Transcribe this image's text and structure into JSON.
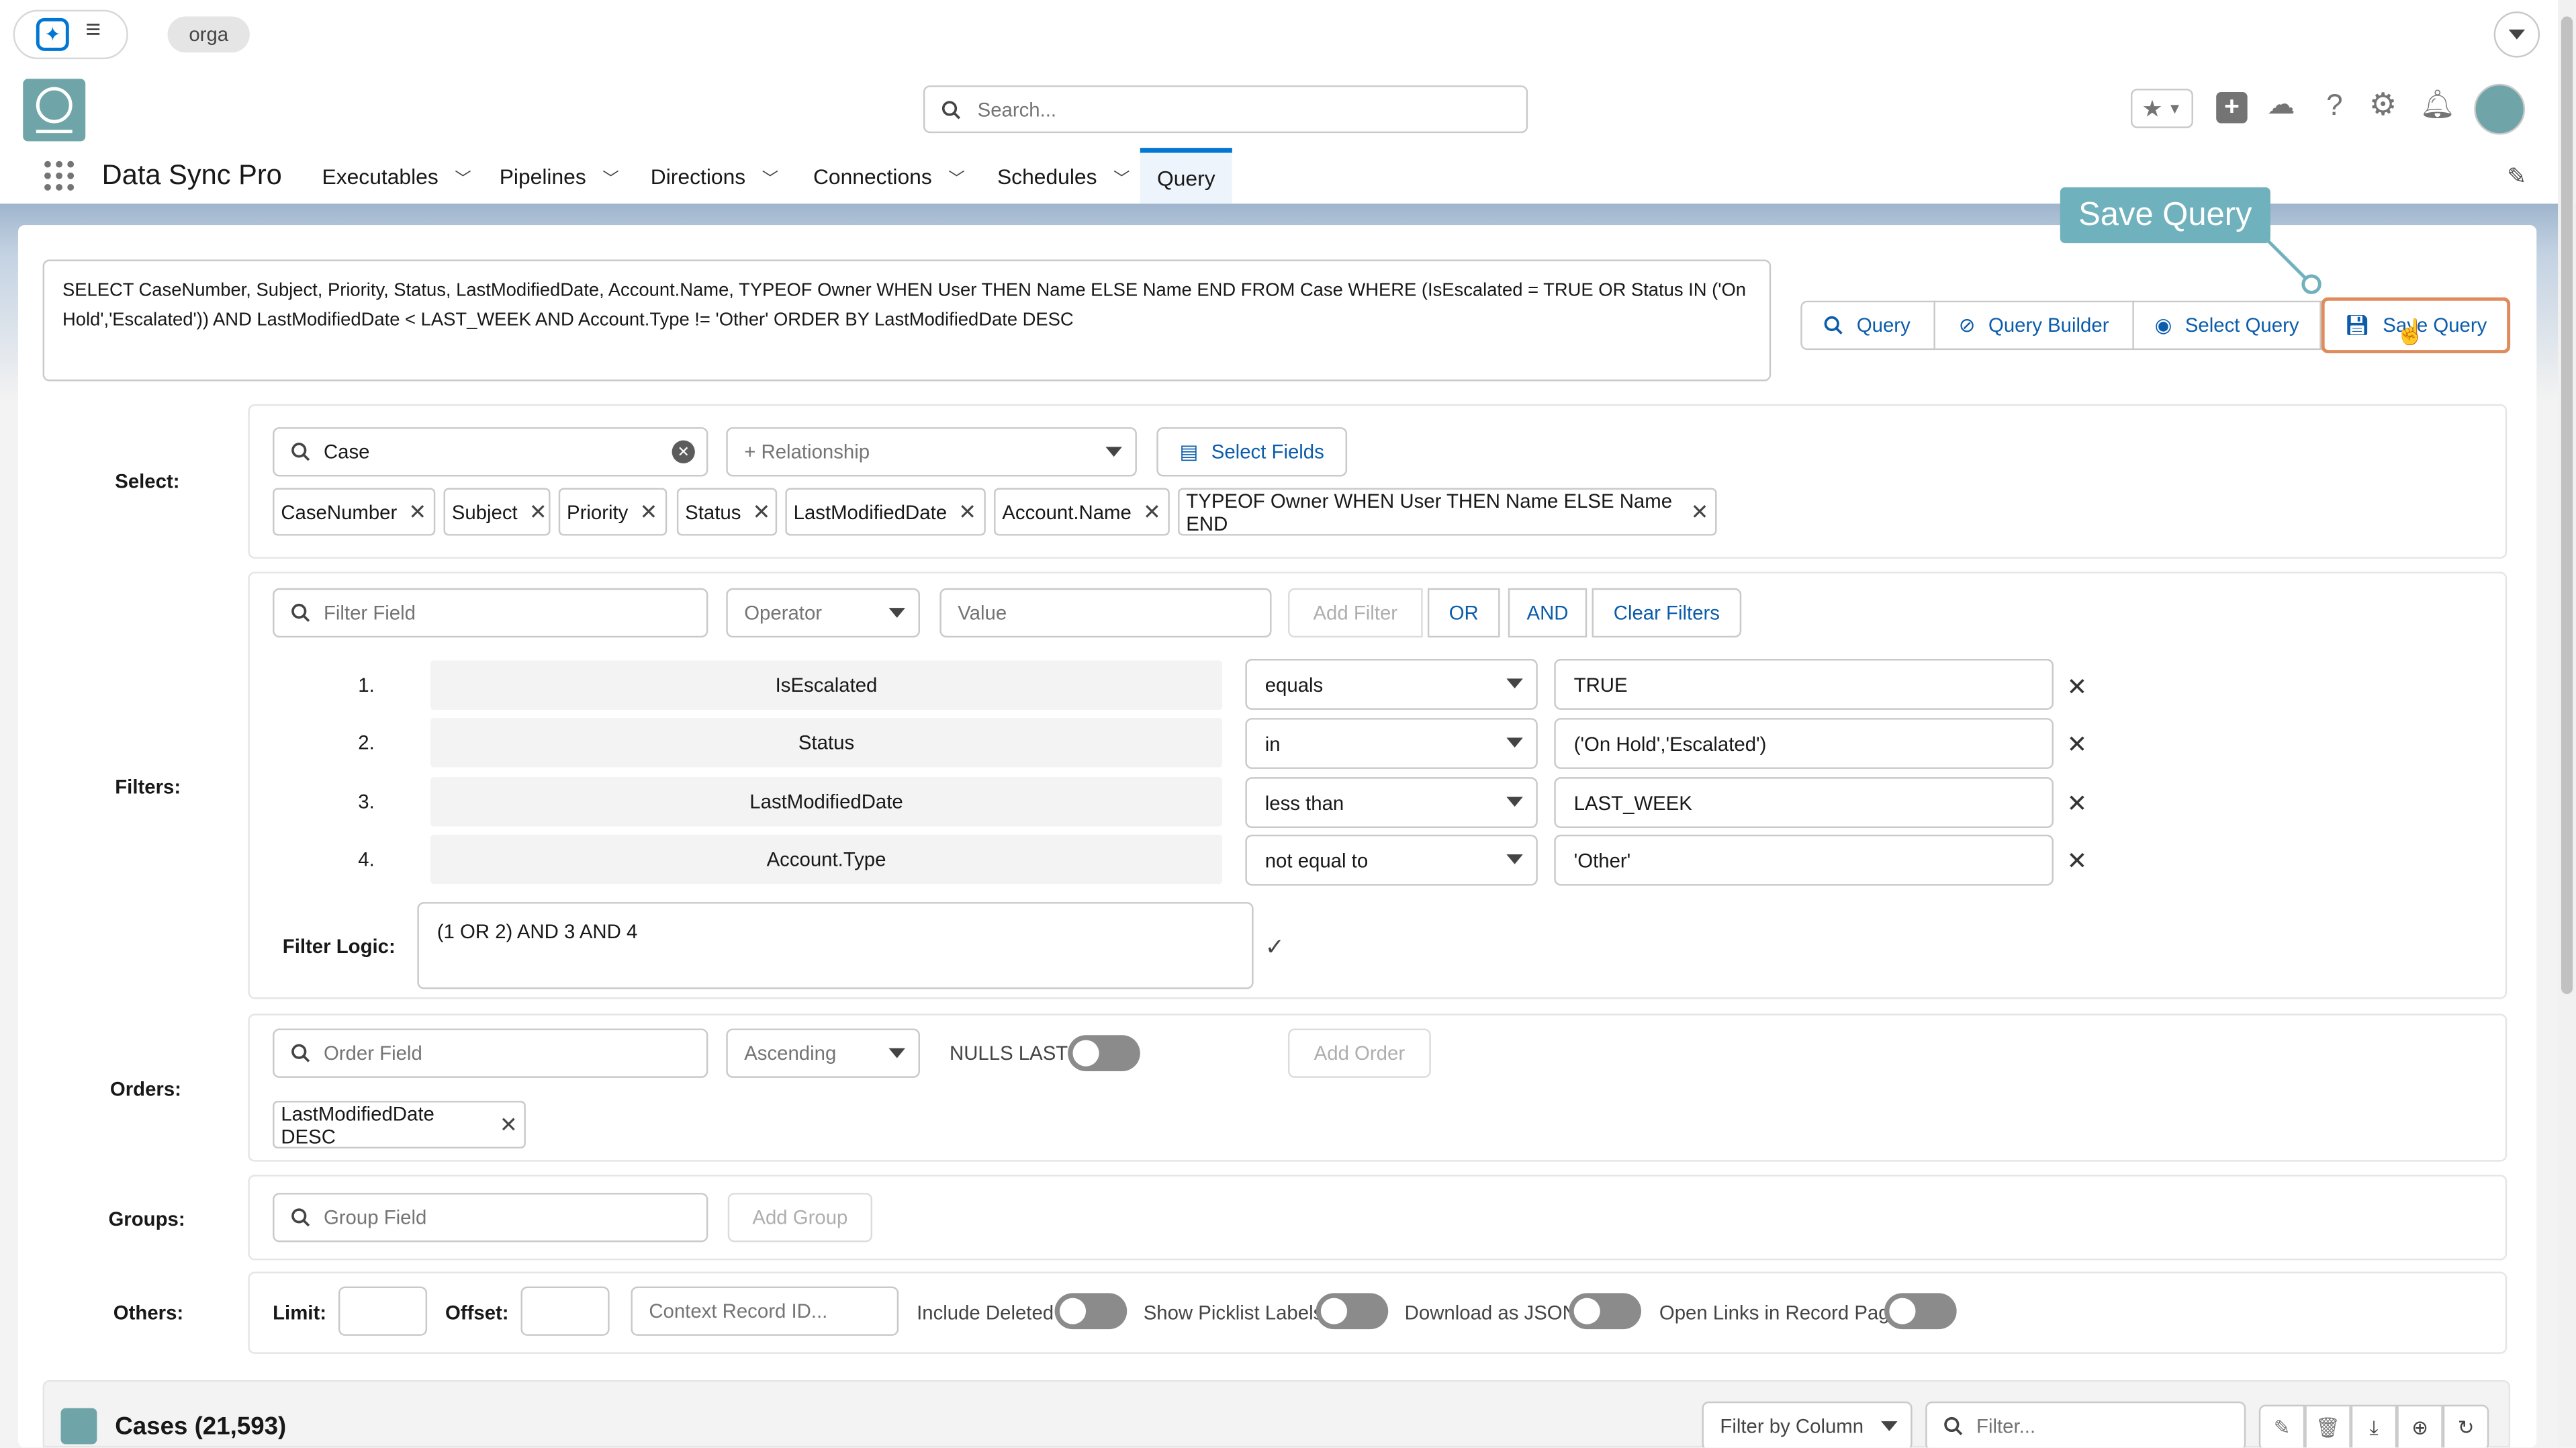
{
  "topbar": {
    "org_label": "orga"
  },
  "header": {
    "search_placeholder": "Search..."
  },
  "app": {
    "name": "Data Sync Pro"
  },
  "nav": {
    "items": [
      {
        "label": "Executables"
      },
      {
        "label": "Pipelines"
      },
      {
        "label": "Directions"
      },
      {
        "label": "Connections"
      },
      {
        "label": "Schedules"
      },
      {
        "label": "Query"
      }
    ],
    "active": "Query"
  },
  "tooltip": {
    "text": "Save Query"
  },
  "query_text": "SELECT CaseNumber, Subject, Priority, Status, LastModifiedDate, Account.Name, TYPEOF Owner WHEN User THEN Name ELSE Name END FROM Case WHERE (IsEscalated = TRUE OR Status IN ('On Hold','Escalated')) AND LastModifiedDate < LAST_WEEK AND Account.Type != 'Other' ORDER BY LastModifiedDate DESC",
  "actions": {
    "query": "Query",
    "query_builder": "Query Builder",
    "select_query": "Select Query",
    "save_query": "Save Query"
  },
  "select": {
    "label": "Select:",
    "object": "Case",
    "relationship_placeholder": "+ Relationship",
    "select_fields": "Select Fields",
    "fields": [
      "CaseNumber",
      "Subject",
      "Priority",
      "Status",
      "LastModifiedDate",
      "Account.Name",
      "TYPEOF Owner WHEN User THEN Name ELSE Name END"
    ]
  },
  "filters": {
    "label": "Filters:",
    "field_placeholder": "Filter Field",
    "operator_placeholder": "Operator",
    "value_placeholder": "Value",
    "add_filter": "Add Filter",
    "or": "OR",
    "and": "AND",
    "clear": "Clear Filters",
    "rows": [
      {
        "num": "1.",
        "field": "IsEscalated",
        "op": "equals",
        "value": "TRUE"
      },
      {
        "num": "2.",
        "field": "Status",
        "op": "in",
        "value": "('On Hold','Escalated')"
      },
      {
        "num": "3.",
        "field": "LastModifiedDate",
        "op": "less than",
        "value": "LAST_WEEK"
      },
      {
        "num": "4.",
        "field": "Account.Type",
        "op": "not equal to",
        "value": "'Other'"
      }
    ],
    "logic_label": "Filter Logic:",
    "logic": "(1 OR 2) AND 3 AND 4"
  },
  "orders": {
    "label": "Orders:",
    "field_placeholder": "Order Field",
    "direction": "Ascending",
    "nulls_label": "NULLS LAST?",
    "add_order": "Add Order",
    "items": [
      "LastModifiedDate DESC"
    ]
  },
  "groups": {
    "label": "Groups:",
    "field_placeholder": "Group Field",
    "add_group": "Add Group"
  },
  "others": {
    "label": "Others:",
    "limit_label": "Limit:",
    "offset_label": "Offset:",
    "context_placeholder": "Context Record ID...",
    "include_deleted": "Include Deleted",
    "show_picklist": "Show Picklist Labels",
    "download_json": "Download as JSON",
    "open_links": "Open Links in Record Page"
  },
  "results": {
    "title": "Cases (21,593)",
    "filter_by_column": "Filter by Column",
    "filter_placeholder": "Filter..."
  }
}
